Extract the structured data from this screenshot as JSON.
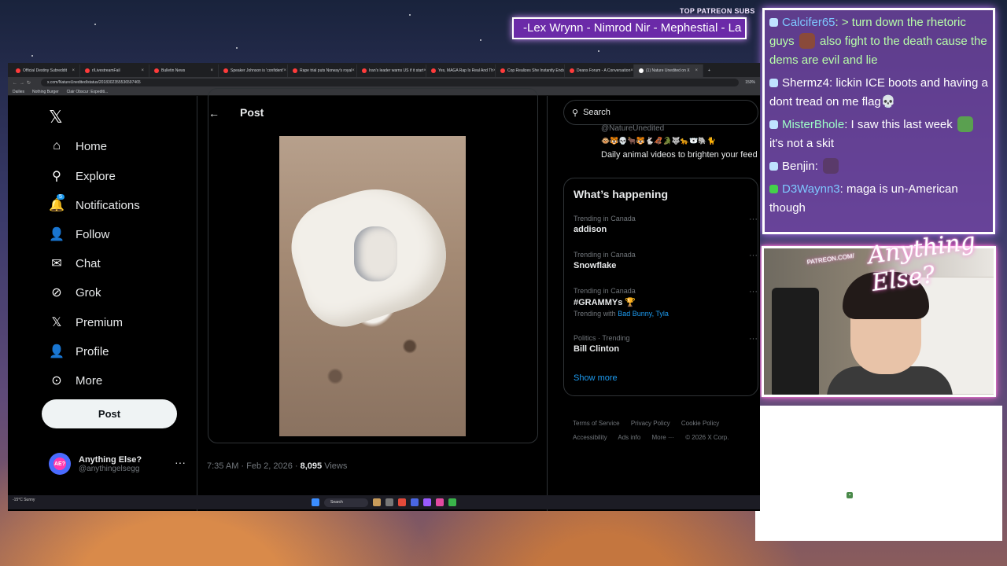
{
  "overlay": {
    "patreon_label": "TOP PATREON SUBS",
    "ticker_text": "-Lex Wrynn - Nimrod Nir - Mephestial - La",
    "brand_text": "Anything Else?",
    "patreon_url": "PATREON.COM/"
  },
  "chat": [
    {
      "user": "Calcifer65",
      "color": "#7ec8ff",
      "text": ": > turn down the rhetoric guys ",
      "text2": " also fight to the death cause the dems are evil and lie",
      "text_color": "#b8ffa8"
    },
    {
      "user": "Shermz4",
      "color": "#ffffff",
      "text": ": lickin ICE boots and having a dont tread on me flag",
      "text2": "💀",
      "text_color": "#ffffff"
    },
    {
      "user": "MisterBhole",
      "color": "#9effc8",
      "text": ": I saw this last week ",
      "text2": " it's not a skit",
      "text_color": "#ffffff"
    },
    {
      "user": "Benjin",
      "color": "#ffffff",
      "text": ": ",
      "text2": "",
      "text_color": "#ffffff"
    },
    {
      "user": "D3Waynn3",
      "color": "#7ec8ff",
      "text": ": maga is un-American though",
      "text2": "",
      "text_color": "#ffffff"
    }
  ],
  "browser": {
    "tabs": [
      "Official Destiny Subreddit",
      "r/LivestreamFail",
      "Bulletin News",
      "Speaker Johnson is 'confident'",
      "Rape trial puts Norway's royal",
      "Iran's leader warns US if it start",
      "Yes, MAGA Rap Is Real And Th",
      "Cop Realizes She Instantly Ends",
      "Deans Forum - A Conversation",
      "(1) Nature Unedited on X"
    ],
    "url": "x.com/NatureUnedited/status/2018302355536597465",
    "zoom": "150%",
    "bookmarks": [
      "Dailies",
      "Nothing Burger",
      "Clair Obscur: Expediti..."
    ]
  },
  "x": {
    "nav": [
      {
        "label": "Home",
        "icon": "home-icon",
        "glyph": "⌂"
      },
      {
        "label": "Explore",
        "icon": "search-icon",
        "glyph": "⚲"
      },
      {
        "label": "Notifications",
        "icon": "bell-icon",
        "glyph": "🔔"
      },
      {
        "label": "Follow",
        "icon": "follow-icon",
        "glyph": "👤"
      },
      {
        "label": "Chat",
        "icon": "mail-icon",
        "glyph": "✉"
      },
      {
        "label": "Grok",
        "icon": "grok-icon",
        "glyph": "⊘"
      },
      {
        "label": "Premium",
        "icon": "x-logo-icon",
        "glyph": "𝕏"
      },
      {
        "label": "Profile",
        "icon": "profile-icon",
        "glyph": "👤"
      },
      {
        "label": "More",
        "icon": "more-icon",
        "glyph": "⋯"
      }
    ],
    "notif_count": "5",
    "post_button": "Post",
    "account_name": "Anything Else?",
    "account_handle": "@anythingelsegg",
    "post_title": "Post",
    "post_time": "7:35 AM · Feb 2, 2026 · ",
    "post_views_count": "8,095",
    "post_views_label": "Views",
    "search_placeholder": "Search",
    "who_handle": "@NatureUnedited",
    "who_emojis": "🐵🐯💀🐂🐯🐇🦧🐊🐺🐆🐻‍❄️🐘🐈",
    "who_bio": "Daily animal videos to brighten your feed",
    "happening_title": "What’s happening",
    "trends": [
      {
        "context": "Trending in Canada",
        "title": "addison",
        "with": ""
      },
      {
        "context": "Trending in Canada",
        "title": "Snowflake",
        "with": ""
      },
      {
        "context": "Trending in Canada",
        "title": "#GRAMMYs",
        "with_label": "Trending with",
        "with": "Bad Bunny, Tyla"
      },
      {
        "context": "Politics · Trending",
        "title": "Bill Clinton",
        "with": ""
      }
    ],
    "show_more": "Show more",
    "footer": [
      "Terms of Service",
      "Privacy Policy",
      "Cookie Policy",
      "Accessibility",
      "Ads info",
      "More ···",
      "© 2026 X Corp."
    ]
  },
  "taskbar": {
    "weather": "-15°C Sunny",
    "search": "Search"
  }
}
